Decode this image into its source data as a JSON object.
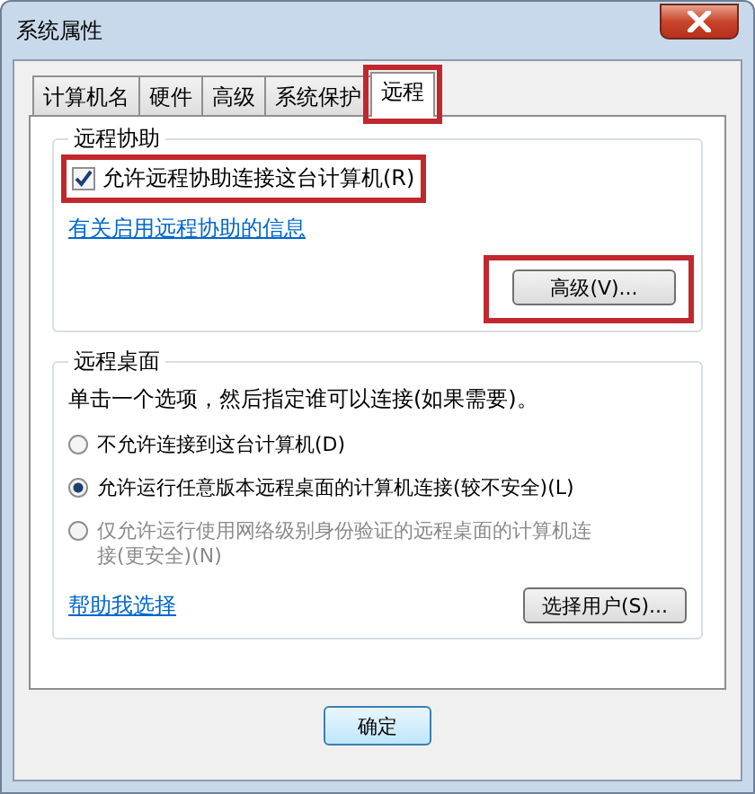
{
  "window": {
    "title": "系统属性"
  },
  "tabs": [
    {
      "label": "计算机名",
      "selected": false,
      "highlighted": false
    },
    {
      "label": "硬件",
      "selected": false,
      "highlighted": false
    },
    {
      "label": "高级",
      "selected": false,
      "highlighted": false
    },
    {
      "label": "系统保护",
      "selected": false,
      "highlighted": false
    },
    {
      "label": "远程",
      "selected": true,
      "highlighted": true
    }
  ],
  "remote_assistance": {
    "title": "远程协助",
    "checkbox": {
      "label": "允许远程协助连接这台计算机(R)",
      "checked": true,
      "highlighted": true
    },
    "link": "有关启用远程协助的信息",
    "button": {
      "label": "高级(V)...",
      "highlighted": true
    }
  },
  "remote_desktop": {
    "title": "远程桌面",
    "description": "单击一个选项，然后指定谁可以连接(如果需要)。",
    "options": [
      {
        "label": "不允许连接到这台计算机(D)",
        "selected": false,
        "disabled": false
      },
      {
        "label": "允许运行任意版本远程桌面的计算机连接(较不安全)(L)",
        "selected": true,
        "disabled": false
      },
      {
        "label": "仅允许运行使用网络级别身份验证的远程桌面的计算机连接(更安全)(N)",
        "selected": false,
        "disabled": true
      }
    ],
    "link": "帮助我选择",
    "button": "选择用户(S)..."
  },
  "buttons": [
    "确定"
  ]
}
